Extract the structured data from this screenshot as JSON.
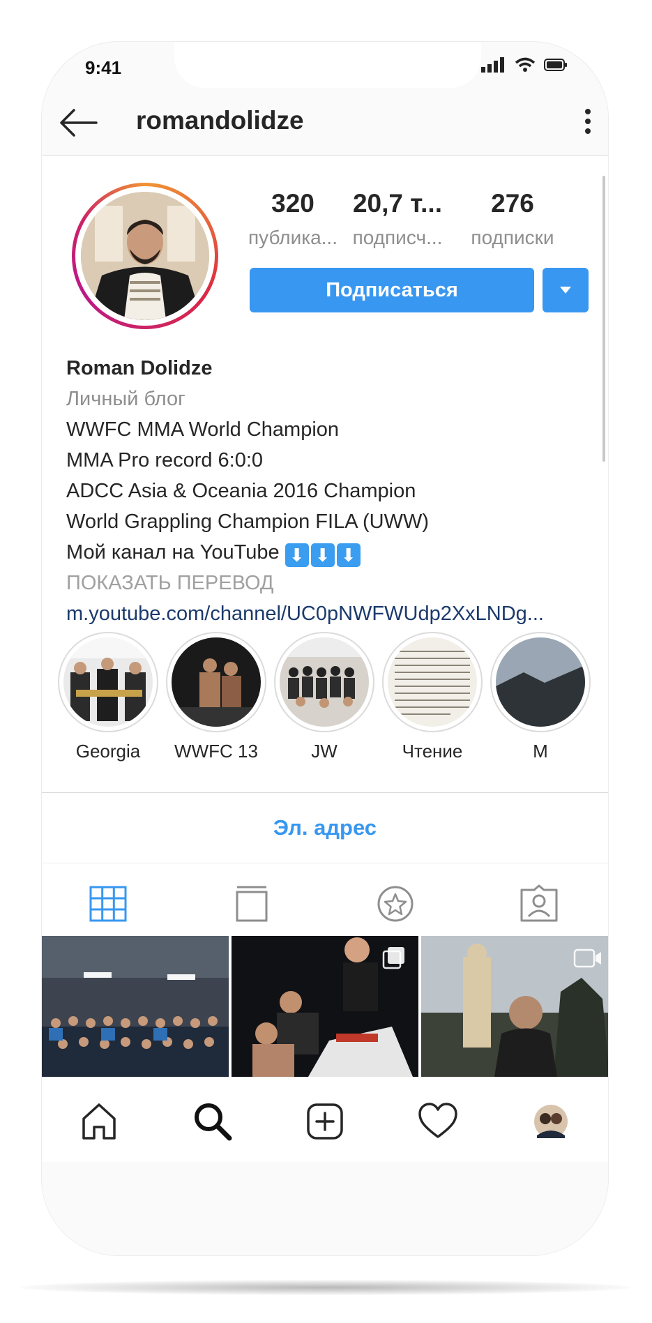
{
  "status_bar": {
    "time": "9:41"
  },
  "header": {
    "username": "romandolidze"
  },
  "stats": [
    {
      "value": "320",
      "label": "публика..."
    },
    {
      "value": "20,7 т...",
      "label": "подписч..."
    },
    {
      "value": "276",
      "label": "подписки"
    }
  ],
  "follow_button": {
    "label": "Подписаться"
  },
  "bio": {
    "name": "Roman Dolidze",
    "category": "Личный блог",
    "lines": [
      "WWFC MMA  World Champion",
      "MMA Pro record 6:0:0",
      "ADCC Asia & Oceania 2016 Champion",
      "World Grappling Champion FILA (UWW)",
      "Мой канал на YouTube"
    ],
    "emoji": "⬇",
    "translate": "ПОКАЗАТЬ ПЕРЕВОД",
    "link": "m.youtube.com/channel/UC0pNWFWUdp2XxLNDg..."
  },
  "highlights": [
    {
      "label": "Georgia"
    },
    {
      "label": "WWFC 13"
    },
    {
      "label": "JW"
    },
    {
      "label": "Чтение"
    },
    {
      "label": "M"
    }
  ],
  "email_button": {
    "label": "Эл. адрес"
  },
  "colors": {
    "accent": "#3897f0",
    "text": "#262626",
    "muted": "#8e8e8e",
    "link": "#1b3a6b"
  }
}
